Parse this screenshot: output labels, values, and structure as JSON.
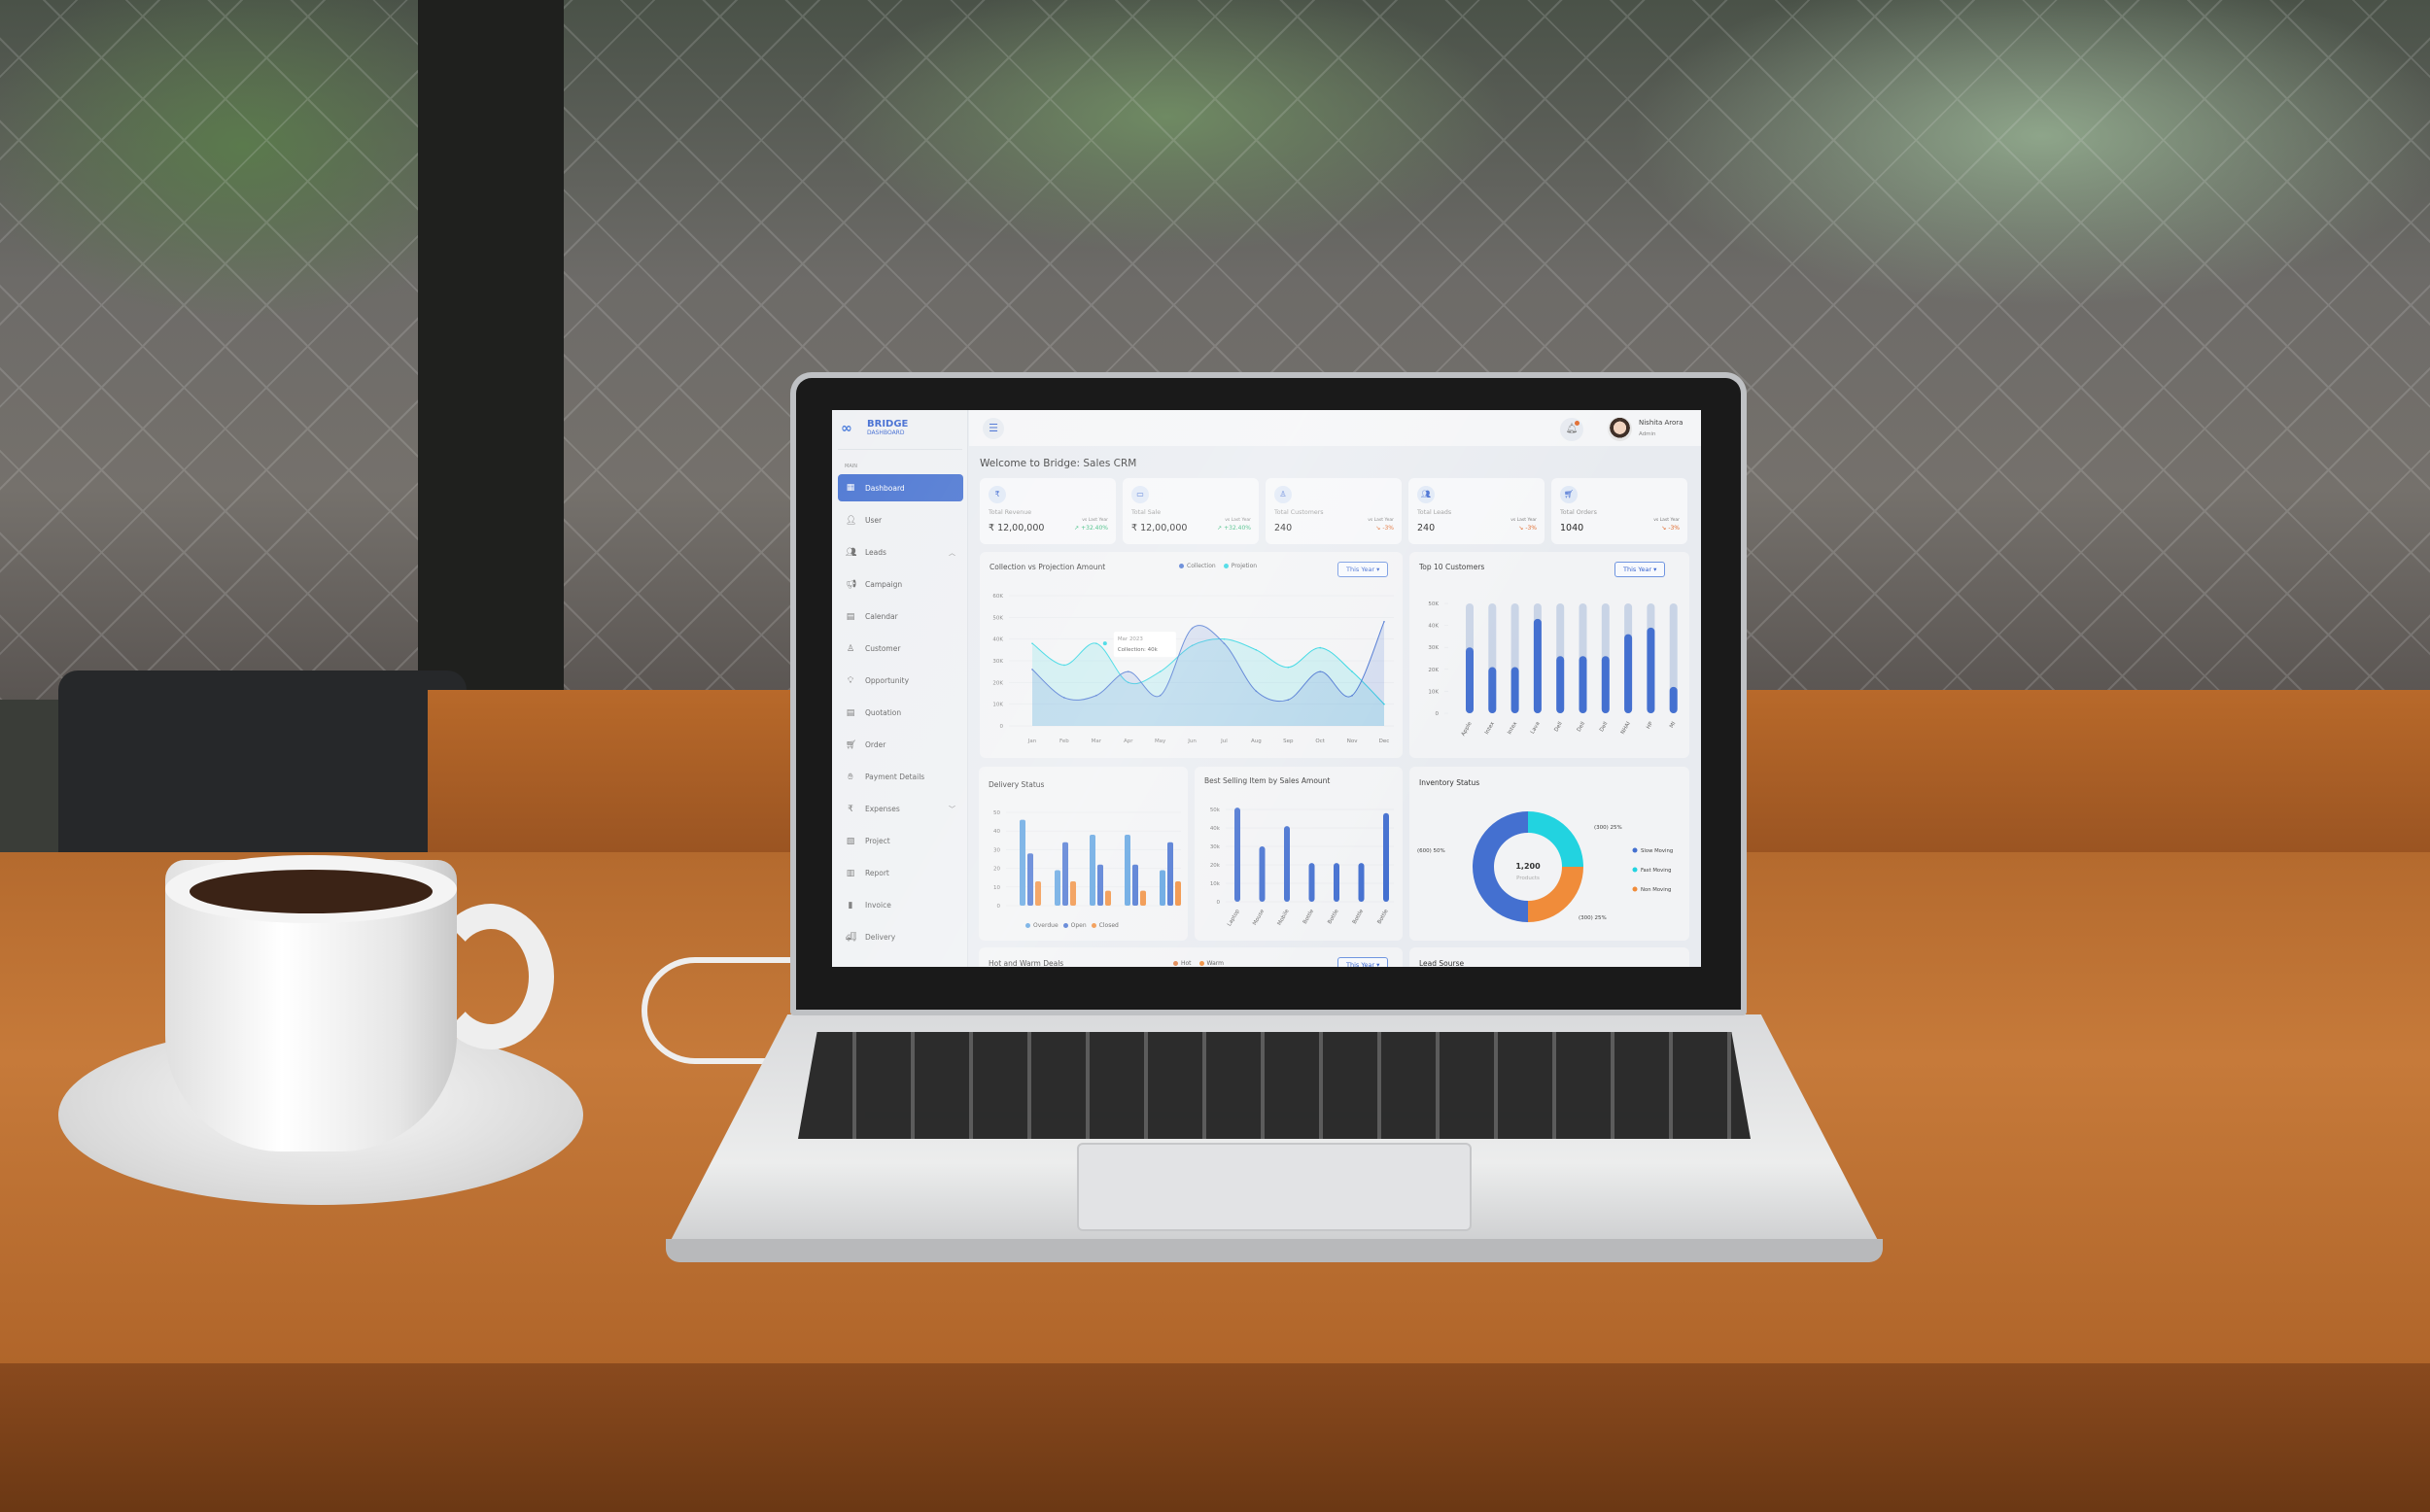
{
  "app": {
    "logo_line1": "BRIDGE",
    "logo_line2": "DASHBOARD"
  },
  "sidebar": {
    "section_label": "MAIN",
    "items": [
      {
        "label": "Dashboard",
        "icon": "dashboard-icon",
        "active": true
      },
      {
        "label": "User",
        "icon": "user-icon"
      },
      {
        "label": "Leads",
        "icon": "leads-icon",
        "chevron": "up"
      },
      {
        "label": "Campaign",
        "icon": "megaphone-icon"
      },
      {
        "label": "Calendar",
        "icon": "calendar-icon"
      },
      {
        "label": "Customer",
        "icon": "customer-icon"
      },
      {
        "label": "Opportunity",
        "icon": "lightbulb-icon"
      },
      {
        "label": "Quotation",
        "icon": "document-icon"
      },
      {
        "label": "Order",
        "icon": "cart-icon"
      },
      {
        "label": "Payment Details",
        "icon": "payment-icon"
      },
      {
        "label": "Expenses",
        "icon": "rupee-icon",
        "chevron": "down"
      },
      {
        "label": "Project",
        "icon": "project-icon"
      },
      {
        "label": "Report",
        "icon": "report-icon"
      },
      {
        "label": "Invoice",
        "icon": "invoice-icon"
      },
      {
        "label": "Delivery",
        "icon": "truck-icon"
      }
    ]
  },
  "header": {
    "user_name": "Nishita Arora",
    "user_role": "Admin"
  },
  "welcome": "Welcome to Bridge: Sales CRM",
  "stats": [
    {
      "label": "Total Revenue",
      "value": "₹ 12,00,000",
      "compare": "vs Last Year",
      "change": "+32.40%",
      "trend": "up",
      "icon": "rupee-icon"
    },
    {
      "label": "Total Sale",
      "value": "₹ 12,00,000",
      "compare": "vs Last Year",
      "change": "+32.40%",
      "trend": "up",
      "icon": "cash-icon"
    },
    {
      "label": "Total Customers",
      "value": "240",
      "compare": "vs Last Year",
      "change": "-3%",
      "trend": "down",
      "icon": "customer-icon"
    },
    {
      "label": "Total Leads",
      "value": "240",
      "compare": "vs Last Year",
      "change": "-3%",
      "trend": "down",
      "icon": "leads-icon"
    },
    {
      "label": "Total Orders",
      "value": "1040",
      "compare": "vs Last Year",
      "change": "-3%",
      "trend": "down",
      "icon": "cart-icon"
    }
  ],
  "colors": {
    "accent": "#4470d0",
    "cyan": "#22d3e0",
    "orange": "#f08c3a",
    "light_blue": "#5aa0e0",
    "up": "#2bb673",
    "down": "#e06a2c"
  },
  "filter_label": "This Year ▾",
  "chart_data": [
    {
      "type": "area",
      "title": "Collection vs Projection Amount",
      "categories": [
        "Jan",
        "Feb",
        "Mar",
        "Apr",
        "May",
        "Jun",
        "Jul",
        "Aug",
        "Sep",
        "Oct",
        "Nov",
        "Dec"
      ],
      "yticks": [
        "0",
        "10K",
        "20K",
        "30K",
        "40K",
        "50K",
        "60K"
      ],
      "ylim": [
        0,
        60000
      ],
      "series": [
        {
          "name": "Collection",
          "color": "#4470d0",
          "values": [
            26000,
            13000,
            14000,
            25000,
            14000,
            45000,
            38000,
            16000,
            12000,
            25000,
            14000,
            48000
          ]
        },
        {
          "name": "Projetion",
          "color": "#22d3e0",
          "values": [
            38000,
            28000,
            38000,
            20000,
            25000,
            37000,
            40000,
            35000,
            27000,
            36000,
            25000,
            10000
          ]
        }
      ],
      "tooltip": {
        "line1": "Mar 2023",
        "line2": "Collection: 40k"
      },
      "legend": "top"
    },
    {
      "type": "bar",
      "title": "Top 10 Customers",
      "categories": [
        "Apple",
        "Intex",
        "Intex",
        "Lava",
        "Dell",
        "Dell",
        "Dell",
        "NHAI",
        "HP",
        "MI"
      ],
      "values": [
        30000,
        21000,
        21000,
        43000,
        26000,
        26000,
        26000,
        36000,
        39000,
        12000
      ],
      "yticks": [
        "0",
        "10K",
        "20K",
        "30K",
        "40K",
        "50K"
      ],
      "ylim": [
        0,
        50000
      ]
    },
    {
      "type": "bar",
      "title": "Delivery Status",
      "yticks": [
        "0",
        "10",
        "20",
        "30",
        "40",
        "50"
      ],
      "ylim": [
        0,
        50
      ],
      "series": [
        {
          "name": "Overdue",
          "color": "#5aa0e0",
          "values": [
            46,
            19,
            38,
            38,
            19
          ]
        },
        {
          "name": "Open",
          "color": "#4470d0",
          "values": [
            28,
            34,
            22,
            22,
            34
          ]
        },
        {
          "name": "Closed",
          "color": "#f08c3a",
          "values": [
            13,
            13,
            8,
            8,
            13
          ]
        }
      ],
      "legend": "bottom"
    },
    {
      "type": "bar",
      "title": "Best Selling Item by Sales Amount",
      "categories": [
        "Laptop",
        "Mouse",
        "Mobile",
        "Bottle",
        "Bottle",
        "Bottle",
        "Bottle"
      ],
      "values": [
        51000,
        30000,
        41000,
        21000,
        21000,
        21000,
        48000
      ],
      "yticks": [
        "0",
        "10k",
        "20k",
        "30k",
        "40k",
        "50k"
      ],
      "ylim": [
        0,
        50000
      ]
    },
    {
      "type": "pie",
      "title": "Inventory Status",
      "center_value": "1,200",
      "center_label": "Products",
      "slices": [
        {
          "name": "Slow Moving",
          "value": 600,
          "label": "(600) 50%",
          "color": "#4470d0"
        },
        {
          "name": "Fast Moving",
          "value": 300,
          "label": "(300) 25%",
          "color": "#22d3e0"
        },
        {
          "name": "Non Moving",
          "value": 300,
          "label": "(300) 25%",
          "color": "#f08c3a"
        }
      ],
      "legend": "right"
    }
  ],
  "deals": {
    "title": "Hot and Warm Deals",
    "legend": [
      {
        "name": "Hot",
        "color": "#e0824a"
      },
      {
        "name": "Warm",
        "color": "#f08c3a"
      }
    ]
  },
  "lead_source": {
    "title": "Lead Sourse"
  }
}
